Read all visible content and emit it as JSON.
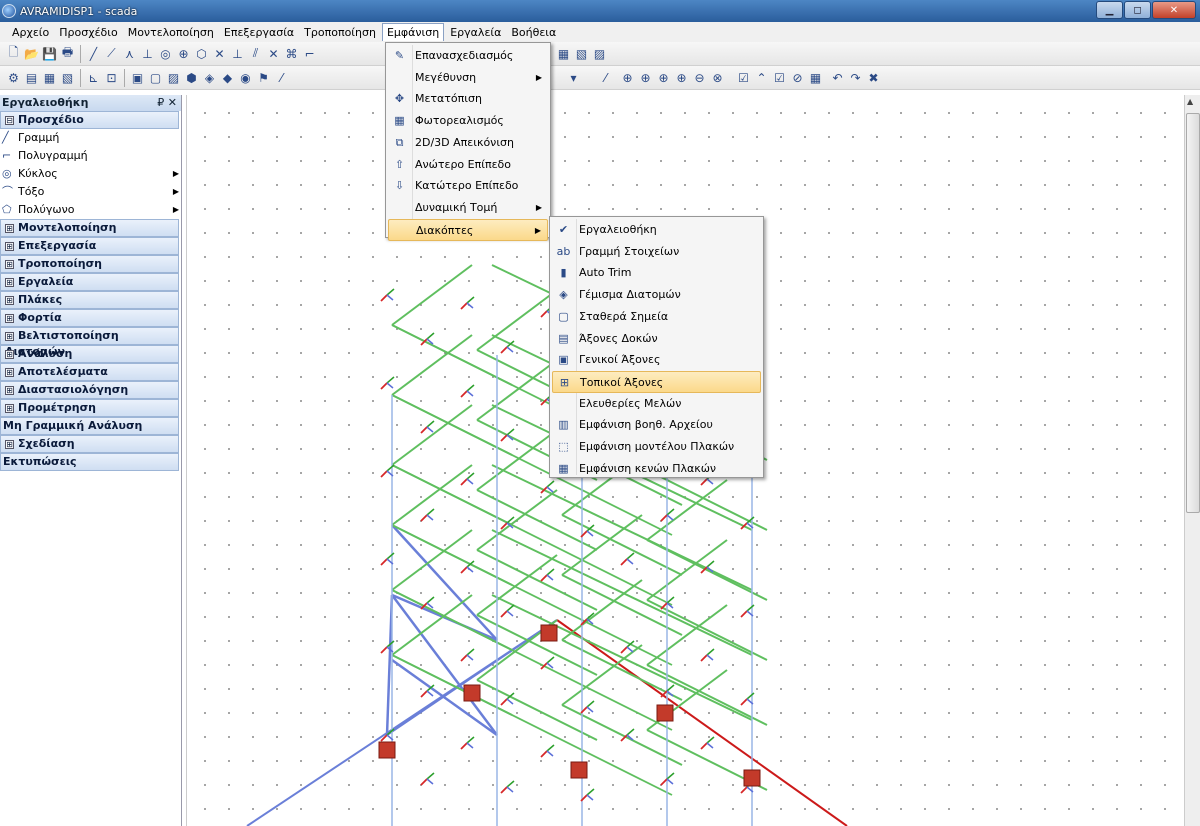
{
  "window": {
    "title": "AVRAMIDISP1 - scada",
    "minimize": "▁",
    "maximize": "◻",
    "close": "✕"
  },
  "menubar": [
    "Αρχείο",
    "Προσχέδιο",
    "Μοντελοποίηση",
    "Επεξεργασία",
    "Τροποποίηση",
    "Εμφάνιση",
    "Εργαλεία",
    "Βοήθεια"
  ],
  "active_menu_index": 5,
  "toolbox": {
    "title": "Εργαλειοθήκη",
    "pin": "₽ ✕",
    "expanded_section": "Προσχέδιο",
    "expanded_items": [
      {
        "label": "Γραμμή",
        "icon": "line-icon",
        "submenu": false
      },
      {
        "label": "Πολυγραμμή",
        "icon": "polyline-icon",
        "submenu": false
      },
      {
        "label": "Κύκλος",
        "icon": "circle-icon",
        "submenu": true
      },
      {
        "label": "Τόξο",
        "icon": "arc-icon",
        "submenu": true
      },
      {
        "label": "Πολύγωνο",
        "icon": "polygon-icon",
        "submenu": true
      }
    ],
    "sections": [
      "Μοντελοποίηση",
      "Επεξεργασία",
      "Τροποποίηση",
      "Εργαλεία",
      "Πλάκες",
      "Φορτία",
      "Βελτιστοποίηση Διατομών",
      "Ανάλυση",
      "Αποτελέσματα",
      "Διαστασιολόγηση",
      "Προμέτρηση"
    ],
    "plain_sections_a": [
      "Μη Γραμμική Ανάλυση"
    ],
    "sections_b": [
      "Σχεδίαση"
    ],
    "plain_sections_b": [
      "Εκτυπώσεις"
    ],
    "collapsed_symbol": "⊟",
    "expand_symbol": "⊞"
  },
  "view_menu": [
    {
      "label": "Επανασχεδιασμός",
      "icon": "redraw-icon",
      "submenu": false
    },
    {
      "label": "Μεγέθυνση",
      "icon": "",
      "submenu": true
    },
    {
      "label": "Μετατόπιση",
      "icon": "pan-icon",
      "submenu": false
    },
    {
      "label": "Φωτορεαλισμός",
      "icon": "photorealism-icon",
      "submenu": false
    },
    {
      "label": "2D/3D Απεικόνιση",
      "icon": "view-2d3d-icon",
      "submenu": false
    },
    {
      "label": "Ανώτερο Επίπεδο",
      "icon": "arrow-up-icon",
      "submenu": false
    },
    {
      "label": "Κατώτερο Επίπεδο",
      "icon": "arrow-down-icon",
      "submenu": false
    },
    {
      "label": "Δυναμική Τομή",
      "icon": "",
      "submenu": true
    },
    {
      "label": "Διακόπτες",
      "icon": "",
      "submenu": true
    }
  ],
  "view_menu_highlight": 8,
  "toggles_menu": [
    {
      "label": "Εργαλειοθήκη",
      "icon": "check-icon"
    },
    {
      "label": "Γραμμή Στοιχείων",
      "icon": "abc-icon"
    },
    {
      "label": "Auto Trim",
      "icon": "trim-icon"
    },
    {
      "label": "Γέμισμα Διατομών",
      "icon": "fill-icon"
    },
    {
      "label": "Σταθερά Σημεία",
      "icon": "fixed-points-icon"
    },
    {
      "label": "Άξονες Δοκών",
      "icon": "beam-axes-icon"
    },
    {
      "label": "Γενικοί Άξονες",
      "icon": "global-axes-icon"
    },
    {
      "label": "Τοπικοί Άξονες",
      "icon": "local-axes-icon"
    },
    {
      "label": "Ελευθερίες Μελών",
      "icon": ""
    },
    {
      "label": "Εμφάνιση βοηθ. Αρχείου",
      "icon": "dwg-icon"
    },
    {
      "label": "Εμφάνιση μοντέλου Πλακών",
      "icon": "slab-model-icon"
    },
    {
      "label": "Εμφάνιση κενών Πλακών",
      "icon": "slab-gaps-icon"
    }
  ],
  "toggles_menu_highlight": 7,
  "colors": {
    "beam": "#5fbf5f",
    "column": "#9ab6e6",
    "brace": "#6a7fd8",
    "red_axis": "#cc1a1a",
    "support": "#c33a2a"
  }
}
